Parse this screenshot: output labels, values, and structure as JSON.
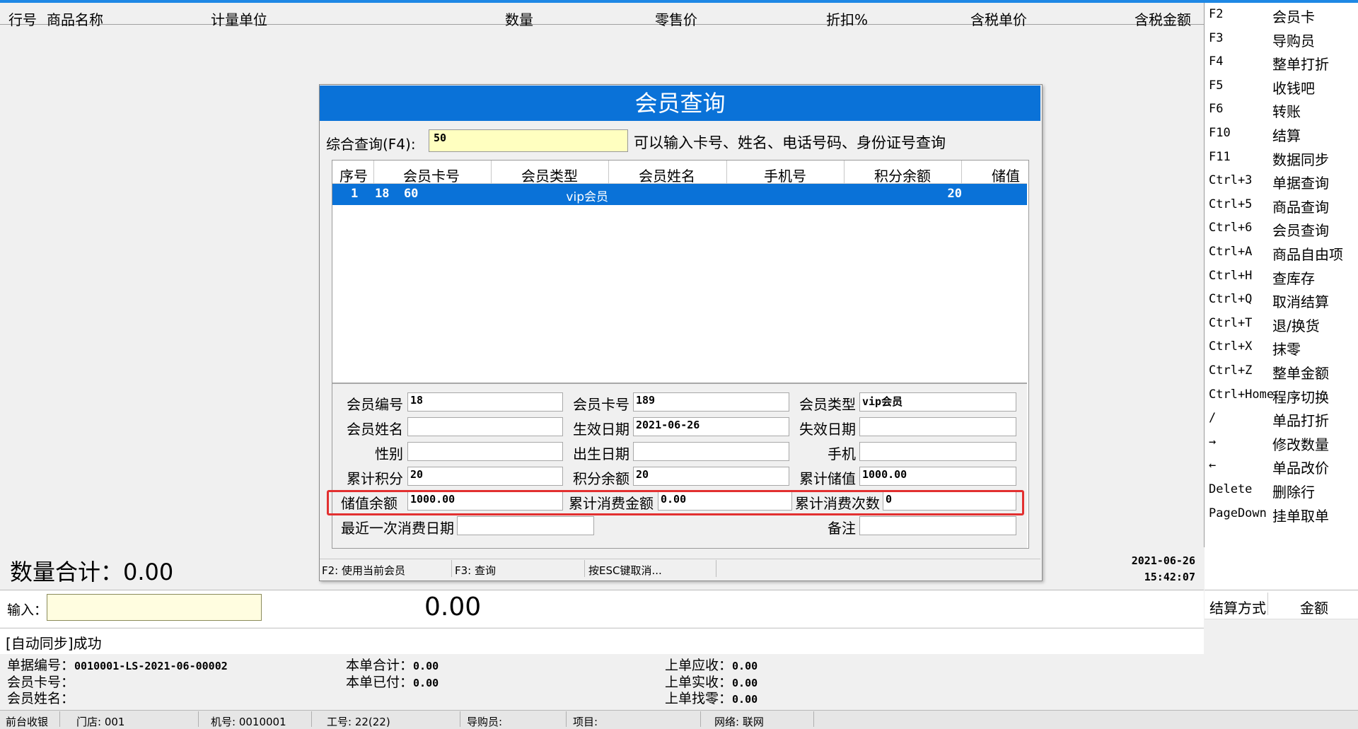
{
  "grid": {
    "columns": [
      "行号",
      "商品名称",
      "计量单位",
      "数量",
      "零售价",
      "折扣%",
      "含税单价",
      "含税金额"
    ]
  },
  "shortcuts": [
    {
      "key": "F2",
      "label": "会员卡"
    },
    {
      "key": "F3",
      "label": "导购员"
    },
    {
      "key": "F4",
      "label": "整单打折"
    },
    {
      "key": "F5",
      "label": "收钱吧"
    },
    {
      "key": "F6",
      "label": "转账"
    },
    {
      "key": "F10",
      "label": "结算"
    },
    {
      "key": "F11",
      "label": "数据同步"
    },
    {
      "key": "Ctrl+3",
      "label": "单据查询"
    },
    {
      "key": "Ctrl+5",
      "label": "商品查询"
    },
    {
      "key": "Ctrl+6",
      "label": "会员查询"
    },
    {
      "key": "Ctrl+A",
      "label": "商品自由项"
    },
    {
      "key": "Ctrl+H",
      "label": "查库存"
    },
    {
      "key": "Ctrl+Q",
      "label": "取消结算"
    },
    {
      "key": "Ctrl+T",
      "label": "退/换货"
    },
    {
      "key": "Ctrl+X",
      "label": "抹零"
    },
    {
      "key": "Ctrl+Z",
      "label": "整单金额"
    },
    {
      "key": "Ctrl+Home",
      "label": "程序切换"
    },
    {
      "key": "/",
      "label": "单品打折"
    },
    {
      "key": "→",
      "label": "修改数量"
    },
    {
      "key": "←",
      "label": "单品改价"
    },
    {
      "key": "Delete",
      "label": "删除行"
    },
    {
      "key": "PageDown",
      "label": "挂单取单"
    }
  ],
  "summary": {
    "qty_total": "数量合计：0.00",
    "date": "2021-06-26",
    "time": "15:42:07",
    "input_label": "输入：",
    "big_amount": "0.00",
    "sync_status": "[自动同步]成功"
  },
  "settlement": {
    "method_header": "结算方式",
    "amount_header": "金额"
  },
  "info": {
    "doc_no_label": "单据编号：",
    "doc_no": "0010001-LS-2021-06-00002",
    "card_label": "会员卡号：",
    "name_label": "会员姓名：",
    "bill_total_label": "本单合计：",
    "bill_total": "0.00",
    "bill_paid_label": "本单已付：",
    "bill_paid": "0.00",
    "prev_due_label": "上单应收：",
    "prev_due": "0.00",
    "prev_paid_label": "上单实收：",
    "prev_paid": "0.00",
    "prev_change_label": "上单找零：",
    "prev_change": "0.00"
  },
  "statusbar": {
    "mode": "前台收银",
    "store": "门店: 001",
    "machine": "机号: 0010001",
    "worker": "工号: 22(22)",
    "guide": "导购员:",
    "project": "项目:",
    "network": "网络: 联网"
  },
  "modal": {
    "title": "会员查询",
    "search_label": "综合查询(F4):",
    "search_value": "50",
    "search_hint": "可以输入卡号、姓名、电话号码、身份证号查询",
    "columns": [
      "序号",
      "会员卡号",
      "会员类型",
      "会员姓名",
      "手机号",
      "积分余额",
      "储值余"
    ],
    "row": {
      "index": "1",
      "card": "18  60",
      "type": "vip会员",
      "name": "",
      "phone": "",
      "points": "20"
    },
    "fields": {
      "member_no_label": "会员编号",
      "member_no": "18",
      "card_no_label": "会员卡号",
      "card_no": "189",
      "member_type_label": "会员类型",
      "member_type": "vip会员",
      "member_name_label": "会员姓名",
      "member_name": "",
      "effective_label": "生效日期",
      "effective": "2021-06-26",
      "expire_label": "失效日期",
      "expire": "",
      "gender_label": "性别",
      "gender": "",
      "birth_label": "出生日期",
      "birth": "",
      "mobile_label": "手机",
      "mobile": "",
      "total_points_label": "累计积分",
      "total_points": "20",
      "points_balance_label": "积分余额",
      "points_balance": "20",
      "total_stored_label": "累计储值",
      "total_stored": "1000.00",
      "stored_balance_label": "储值余额",
      "stored_balance": "1000.00",
      "total_spend_label": "累计消费金额",
      "total_spend": "0.00",
      "spend_count_label": "累计消费次数",
      "spend_count": "0",
      "last_spend_label": "最近一次消费日期",
      "last_spend": "",
      "remark_label": "备注",
      "remark": ""
    },
    "footer": {
      "use_member": "F2: 使用当前会员",
      "query": "F3: 查询",
      "esc": "按ESC键取消..."
    }
  },
  "colors": {
    "accent": "#0a72d8",
    "highlight": "#e23030",
    "input_bg": "#ffffc0"
  }
}
